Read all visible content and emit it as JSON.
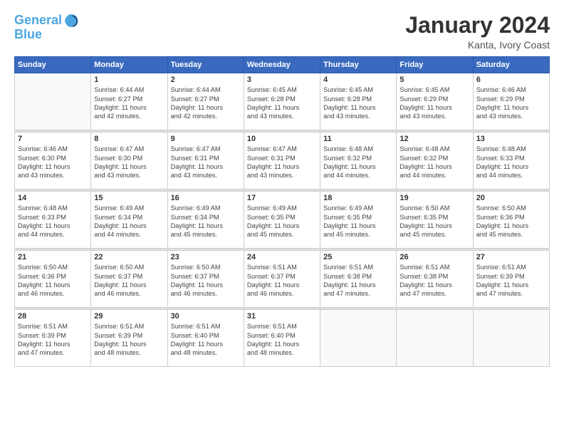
{
  "header": {
    "logo_line1": "General",
    "logo_line2": "Blue",
    "month_title": "January 2024",
    "location": "Kanta, Ivory Coast"
  },
  "weekdays": [
    "Sunday",
    "Monday",
    "Tuesday",
    "Wednesday",
    "Thursday",
    "Friday",
    "Saturday"
  ],
  "weeks": [
    [
      {
        "day": "",
        "info": ""
      },
      {
        "day": "1",
        "info": "Sunrise: 6:44 AM\nSunset: 6:27 PM\nDaylight: 11 hours\nand 42 minutes."
      },
      {
        "day": "2",
        "info": "Sunrise: 6:44 AM\nSunset: 6:27 PM\nDaylight: 11 hours\nand 42 minutes."
      },
      {
        "day": "3",
        "info": "Sunrise: 6:45 AM\nSunset: 6:28 PM\nDaylight: 11 hours\nand 43 minutes."
      },
      {
        "day": "4",
        "info": "Sunrise: 6:45 AM\nSunset: 6:28 PM\nDaylight: 11 hours\nand 43 minutes."
      },
      {
        "day": "5",
        "info": "Sunrise: 6:45 AM\nSunset: 6:29 PM\nDaylight: 11 hours\nand 43 minutes."
      },
      {
        "day": "6",
        "info": "Sunrise: 6:46 AM\nSunset: 6:29 PM\nDaylight: 11 hours\nand 43 minutes."
      }
    ],
    [
      {
        "day": "7",
        "info": "Sunrise: 6:46 AM\nSunset: 6:30 PM\nDaylight: 11 hours\nand 43 minutes."
      },
      {
        "day": "8",
        "info": "Sunrise: 6:47 AM\nSunset: 6:30 PM\nDaylight: 11 hours\nand 43 minutes."
      },
      {
        "day": "9",
        "info": "Sunrise: 6:47 AM\nSunset: 6:31 PM\nDaylight: 11 hours\nand 43 minutes."
      },
      {
        "day": "10",
        "info": "Sunrise: 6:47 AM\nSunset: 6:31 PM\nDaylight: 11 hours\nand 43 minutes."
      },
      {
        "day": "11",
        "info": "Sunrise: 6:48 AM\nSunset: 6:32 PM\nDaylight: 11 hours\nand 44 minutes."
      },
      {
        "day": "12",
        "info": "Sunrise: 6:48 AM\nSunset: 6:32 PM\nDaylight: 11 hours\nand 44 minutes."
      },
      {
        "day": "13",
        "info": "Sunrise: 6:48 AM\nSunset: 6:33 PM\nDaylight: 11 hours\nand 44 minutes."
      }
    ],
    [
      {
        "day": "14",
        "info": "Sunrise: 6:48 AM\nSunset: 6:33 PM\nDaylight: 11 hours\nand 44 minutes."
      },
      {
        "day": "15",
        "info": "Sunrise: 6:49 AM\nSunset: 6:34 PM\nDaylight: 11 hours\nand 44 minutes."
      },
      {
        "day": "16",
        "info": "Sunrise: 6:49 AM\nSunset: 6:34 PM\nDaylight: 11 hours\nand 45 minutes."
      },
      {
        "day": "17",
        "info": "Sunrise: 6:49 AM\nSunset: 6:35 PM\nDaylight: 11 hours\nand 45 minutes."
      },
      {
        "day": "18",
        "info": "Sunrise: 6:49 AM\nSunset: 6:35 PM\nDaylight: 11 hours\nand 45 minutes."
      },
      {
        "day": "19",
        "info": "Sunrise: 6:50 AM\nSunset: 6:35 PM\nDaylight: 11 hours\nand 45 minutes."
      },
      {
        "day": "20",
        "info": "Sunrise: 6:50 AM\nSunset: 6:36 PM\nDaylight: 11 hours\nand 45 minutes."
      }
    ],
    [
      {
        "day": "21",
        "info": "Sunrise: 6:50 AM\nSunset: 6:36 PM\nDaylight: 11 hours\nand 46 minutes."
      },
      {
        "day": "22",
        "info": "Sunrise: 6:50 AM\nSunset: 6:37 PM\nDaylight: 11 hours\nand 46 minutes."
      },
      {
        "day": "23",
        "info": "Sunrise: 6:50 AM\nSunset: 6:37 PM\nDaylight: 11 hours\nand 46 minutes."
      },
      {
        "day": "24",
        "info": "Sunrise: 6:51 AM\nSunset: 6:37 PM\nDaylight: 11 hours\nand 46 minutes."
      },
      {
        "day": "25",
        "info": "Sunrise: 6:51 AM\nSunset: 6:38 PM\nDaylight: 11 hours\nand 47 minutes."
      },
      {
        "day": "26",
        "info": "Sunrise: 6:51 AM\nSunset: 6:38 PM\nDaylight: 11 hours\nand 47 minutes."
      },
      {
        "day": "27",
        "info": "Sunrise: 6:51 AM\nSunset: 6:39 PM\nDaylight: 11 hours\nand 47 minutes."
      }
    ],
    [
      {
        "day": "28",
        "info": "Sunrise: 6:51 AM\nSunset: 6:39 PM\nDaylight: 11 hours\nand 47 minutes."
      },
      {
        "day": "29",
        "info": "Sunrise: 6:51 AM\nSunset: 6:39 PM\nDaylight: 11 hours\nand 48 minutes."
      },
      {
        "day": "30",
        "info": "Sunrise: 6:51 AM\nSunset: 6:40 PM\nDaylight: 11 hours\nand 48 minutes."
      },
      {
        "day": "31",
        "info": "Sunrise: 6:51 AM\nSunset: 6:40 PM\nDaylight: 11 hours\nand 48 minutes."
      },
      {
        "day": "",
        "info": ""
      },
      {
        "day": "",
        "info": ""
      },
      {
        "day": "",
        "info": ""
      }
    ]
  ]
}
